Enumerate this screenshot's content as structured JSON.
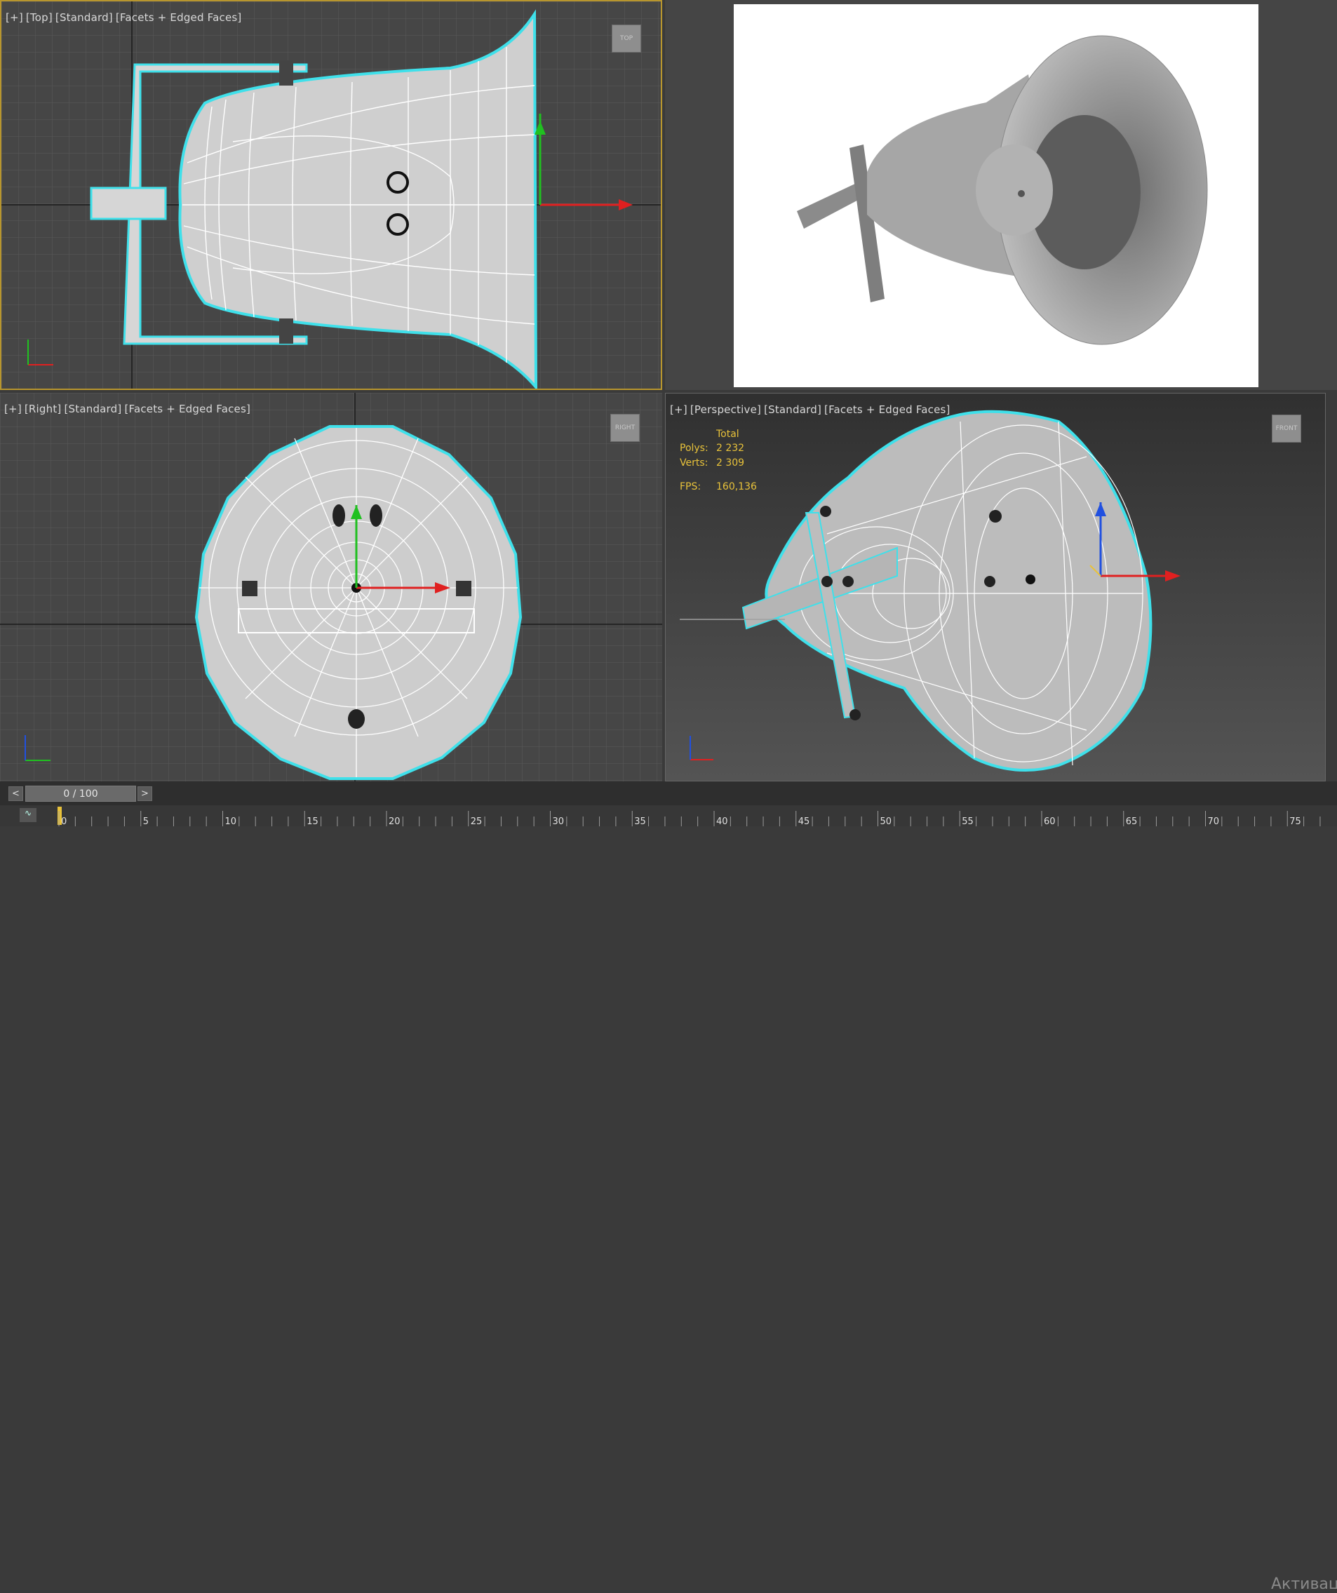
{
  "viewports": {
    "top": {
      "labels": [
        "[+]",
        "[Top]",
        "[Standard]",
        "[Facets + Edged Faces]"
      ],
      "cube_label": "TOP"
    },
    "right": {
      "labels": [
        "[+]",
        "[Right]",
        "[Standard]",
        "[Facets + Edged Faces]"
      ],
      "cube_label": "RIGHT"
    },
    "perspective": {
      "labels": [
        "[+]",
        "[Perspective]",
        "[Standard]",
        "[Facets + Edged Faces]"
      ],
      "cube_label": "FRONT"
    }
  },
  "stats": {
    "header": "Total",
    "polys_label": "Polys:",
    "polys_value": "2 232",
    "verts_label": "Verts:",
    "verts_value": "2 309",
    "fps_label": "FPS:",
    "fps_value": "160,136"
  },
  "timeline": {
    "prev": "<",
    "next": ">",
    "frame": "0 / 100",
    "ticks": [
      "0",
      "5",
      "10",
      "15",
      "20",
      "25",
      "30",
      "35",
      "40",
      "45",
      "50",
      "55",
      "60",
      "65",
      "70",
      "75"
    ]
  },
  "watermark": "Активац",
  "colors": {
    "selection": "#3fe0ea",
    "active_border": "#b8962e",
    "axis_x": "#e02020",
    "axis_y": "#20c020",
    "axis_z": "#2050e0",
    "stats": "#e8c23a"
  }
}
